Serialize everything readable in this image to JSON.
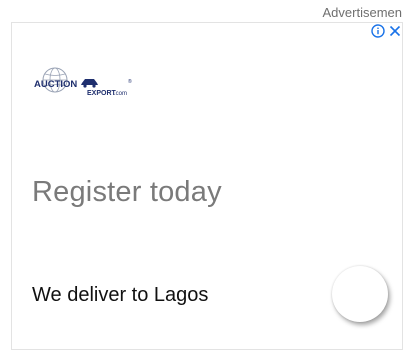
{
  "ad": {
    "label": "Advertisemen",
    "headline": "Register today",
    "subline": "We deliver to Lagos",
    "logo": {
      "line1": "AUCTION",
      "line2": "EXPORT",
      "suffix": ".com",
      "registered": "®"
    }
  },
  "icons": {
    "info": "info-icon",
    "close": "close-icon",
    "globe": "globe-icon",
    "car": "car-icon"
  },
  "colors": {
    "adchoices_blue": "#1a73e8",
    "logo_navy": "#1f2f6e",
    "headline_gray": "#7a7a7a",
    "subline_black": "#111111",
    "border": "#e3e3e3"
  }
}
